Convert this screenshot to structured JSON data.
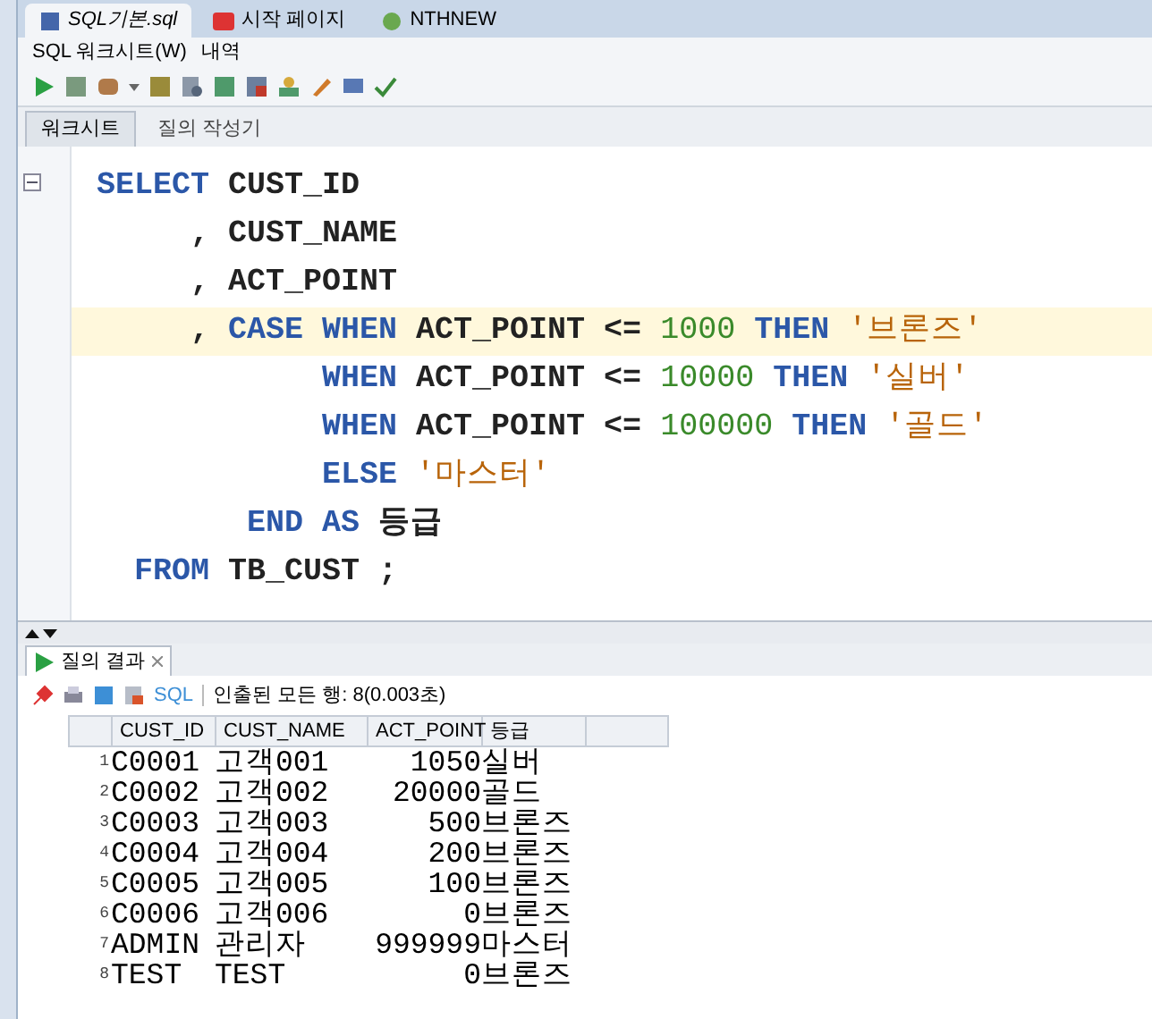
{
  "doc_tabs": [
    {
      "label": "SQL기본.sql",
      "selected": true
    },
    {
      "label": "시작 페이지",
      "selected": false
    },
    {
      "label": "NTHNEW",
      "selected": false
    }
  ],
  "menu": [
    "SQL 워크시트(W)",
    "내역"
  ],
  "sub_tabs": [
    {
      "label": "워크시트",
      "selected": true
    },
    {
      "label": "질의 작성기",
      "selected": false
    }
  ],
  "code_lines": [
    {
      "highlighted": false,
      "tokens": [
        {
          "kind": "kw",
          "text": "SELECT"
        },
        {
          "kind": "id",
          "text": " CUST_ID"
        }
      ]
    },
    {
      "highlighted": false,
      "tokens": [
        {
          "kind": "id",
          "text": "     , CUST_NAME"
        }
      ]
    },
    {
      "highlighted": false,
      "tokens": [
        {
          "kind": "id",
          "text": "     , ACT_POINT"
        }
      ]
    },
    {
      "highlighted": true,
      "tokens": [
        {
          "kind": "id",
          "text": "     , "
        },
        {
          "kind": "kw",
          "text": "CASE WHEN"
        },
        {
          "kind": "id",
          "text": " ACT_POINT <= "
        },
        {
          "kind": "num",
          "text": "1000"
        },
        {
          "kind": "kw",
          "text": " THEN"
        },
        {
          "kind": "str",
          "text": " '브론즈'"
        }
      ]
    },
    {
      "highlighted": false,
      "tokens": [
        {
          "kind": "kw",
          "text": "            WHEN"
        },
        {
          "kind": "id",
          "text": " ACT_POINT <= "
        },
        {
          "kind": "num",
          "text": "10000"
        },
        {
          "kind": "kw",
          "text": " THEN"
        },
        {
          "kind": "str",
          "text": " '실버'"
        }
      ]
    },
    {
      "highlighted": false,
      "tokens": [
        {
          "kind": "kw",
          "text": "            WHEN"
        },
        {
          "kind": "id",
          "text": " ACT_POINT <= "
        },
        {
          "kind": "num",
          "text": "100000"
        },
        {
          "kind": "kw",
          "text": " THEN"
        },
        {
          "kind": "str",
          "text": " '골드'"
        }
      ]
    },
    {
      "highlighted": false,
      "tokens": [
        {
          "kind": "kw",
          "text": "            ELSE"
        },
        {
          "kind": "str",
          "text": " '마스터'"
        }
      ]
    },
    {
      "highlighted": false,
      "tokens": [
        {
          "kind": "kw",
          "text": "        END AS"
        },
        {
          "kind": "id",
          "text": " 등급"
        }
      ]
    },
    {
      "highlighted": false,
      "tokens": [
        {
          "kind": "kw",
          "text": "  FROM"
        },
        {
          "kind": "id",
          "text": " TB_CUST ;"
        }
      ]
    }
  ],
  "results": {
    "tab": "질의 결과",
    "sql_label": "SQL",
    "status": "인출된 모든 행: 8(0.003초)",
    "columns": [
      "CUST_ID",
      "CUST_NAME",
      "ACT_POINT",
      "등급"
    ],
    "rows": [
      {
        "number": "1",
        "cells": [
          "C0001",
          "고객001",
          "1050",
          "실버"
        ]
      },
      {
        "number": "2",
        "cells": [
          "C0002",
          "고객002",
          "20000",
          "골드"
        ]
      },
      {
        "number": "3",
        "cells": [
          "C0003",
          "고객003",
          "500",
          "브론즈"
        ]
      },
      {
        "number": "4",
        "cells": [
          "C0004",
          "고객004",
          "200",
          "브론즈"
        ]
      },
      {
        "number": "5",
        "cells": [
          "C0005",
          "고객005",
          "100",
          "브론즈"
        ]
      },
      {
        "number": "6",
        "cells": [
          "C0006",
          "고객006",
          "0",
          "브론즈"
        ]
      },
      {
        "number": "7",
        "cells": [
          "ADMIN",
          "관리자",
          "999999",
          "마스터"
        ]
      },
      {
        "number": "8",
        "cells": [
          "TEST",
          "TEST",
          "0",
          "브론즈"
        ]
      }
    ]
  }
}
